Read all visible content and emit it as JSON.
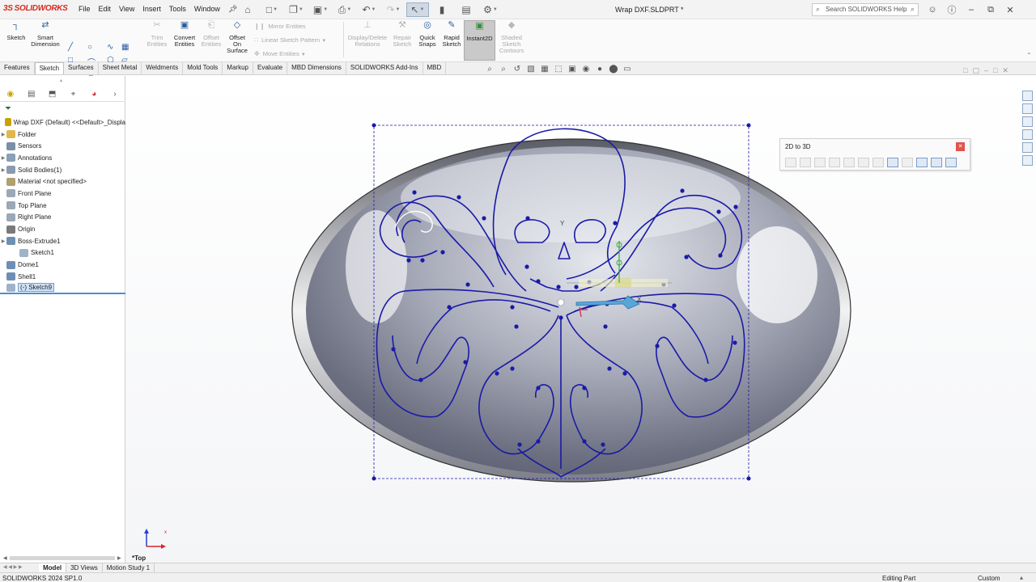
{
  "app": {
    "brand": "SOLIDWORKS",
    "brand_prefix": "3S",
    "document_title": "Wrap DXF.SLDPRT *"
  },
  "menu": [
    "File",
    "Edit",
    "View",
    "Insert",
    "Tools",
    "Window"
  ],
  "search": {
    "placeholder": "Search SOLIDWORKS Help"
  },
  "ribbon": {
    "sketch": "Sketch",
    "smart_dimension": "Smart Dimension",
    "trim_entities": "Trim Entities",
    "convert_entities": "Convert Entities",
    "offset_entities": "Offset Entities",
    "offset_on_surface": "Offset On Surface",
    "mirror_entities": "Mirror Entities",
    "linear_sketch_pattern": "Linear Sketch Pattern",
    "move_entities": "Move Entities",
    "display_delete_relations": "Display/Delete Relations",
    "repair_sketch": "Repair Sketch",
    "quick_snaps": "Quick Snaps",
    "rapid_sketch": "Rapid Sketch",
    "instant2d": "Instant2D",
    "shaded_sketch_contours": "Shaded Sketch Contours"
  },
  "tabs": [
    "Features",
    "Sketch",
    "Surfaces",
    "Sheet Metal",
    "Weldments",
    "Mold Tools",
    "Markup",
    "Evaluate",
    "MBD Dimensions",
    "SOLIDWORKS Add-Ins",
    "MBD"
  ],
  "active_tab": "Sketch",
  "tree": {
    "root": "Wrap DXF (Default) <<Default>_Displa",
    "items": [
      {
        "label": "Folder",
        "icon": "folder-icon",
        "expandable": true
      },
      {
        "label": "Sensors",
        "icon": "sensors-icon",
        "expandable": false
      },
      {
        "label": "Annotations",
        "icon": "annotations-icon",
        "expandable": true
      },
      {
        "label": "Solid Bodies(1)",
        "icon": "solid-bodies-icon",
        "expandable": true
      },
      {
        "label": "Material <not specified>",
        "icon": "material-icon",
        "expandable": false
      },
      {
        "label": "Front Plane",
        "icon": "plane-icon",
        "expandable": false
      },
      {
        "label": "Top Plane",
        "icon": "plane-icon",
        "expandable": false
      },
      {
        "label": "Right Plane",
        "icon": "plane-icon",
        "expandable": false
      },
      {
        "label": "Origin",
        "icon": "origin-icon",
        "expandable": false
      },
      {
        "label": "Boss-Extrude1",
        "icon": "extrude-icon",
        "expandable": true
      },
      {
        "label": "Sketch1",
        "icon": "sketch-icon",
        "expandable": false,
        "indent": true
      },
      {
        "label": "Dome1",
        "icon": "dome-icon",
        "expandable": false
      },
      {
        "label": "Shell1",
        "icon": "shell-icon",
        "expandable": false
      },
      {
        "label": "(-) Sketch9",
        "icon": "sketch-icon",
        "expandable": false,
        "selected": true
      }
    ]
  },
  "floating_toolbar": {
    "title": "2D to 3D"
  },
  "viewport": {
    "view_label": "*Top",
    "axis_y": "Y",
    "axis_x": "X",
    "triad_x": "x"
  },
  "bottom_tabs": [
    "Model",
    "3D Views",
    "Motion Study 1"
  ],
  "status": {
    "left": "SOLIDWORKS 2024 SP1.0",
    "mode": "Editing Part",
    "units": "Custom"
  },
  "colors": {
    "sketch": "#1a1aa8",
    "brand": "#d52b1e",
    "accent": "#2a5d9f"
  }
}
